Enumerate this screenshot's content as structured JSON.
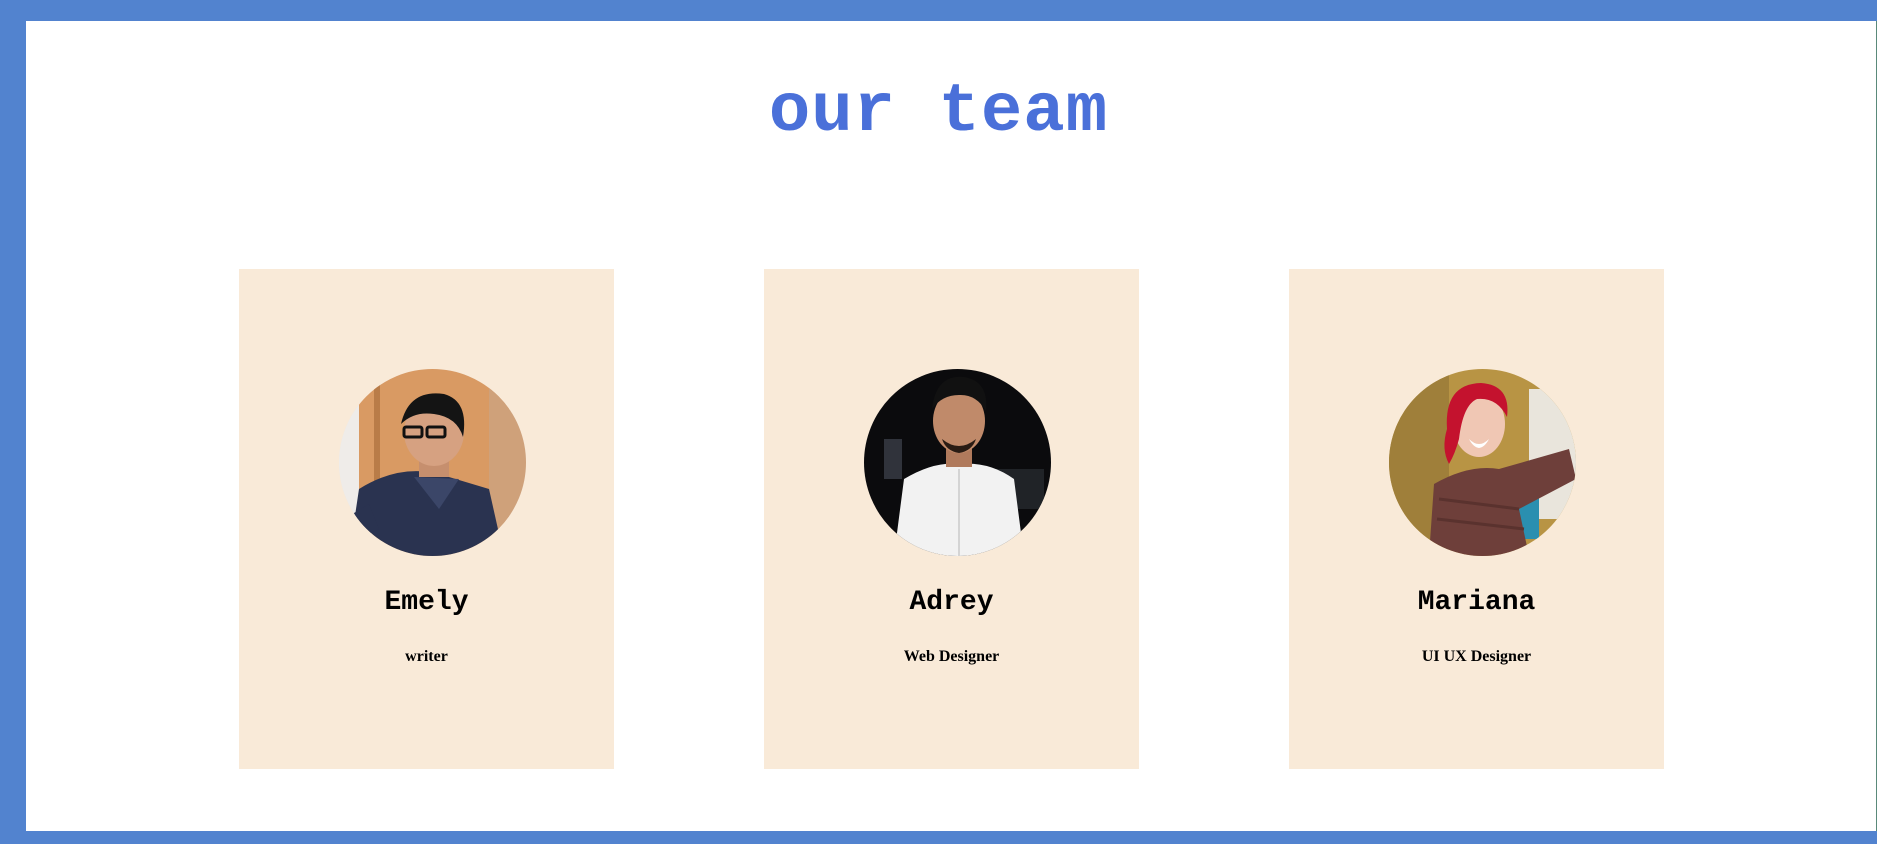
{
  "page": {
    "title": "our team",
    "colors": {
      "frame_border": "#5283cf",
      "title": "#4a70d9",
      "card_background": "#f9ead8"
    }
  },
  "team": [
    {
      "name": "Emely",
      "role": "writer",
      "avatar_icon": "person-photo-man-glasses"
    },
    {
      "name": "Adrey",
      "role": "Web Designer",
      "avatar_icon": "person-photo-man-white-shirt"
    },
    {
      "name": "Mariana",
      "role": "UI UX Designer",
      "avatar_icon": "person-photo-woman-red-hair"
    }
  ]
}
